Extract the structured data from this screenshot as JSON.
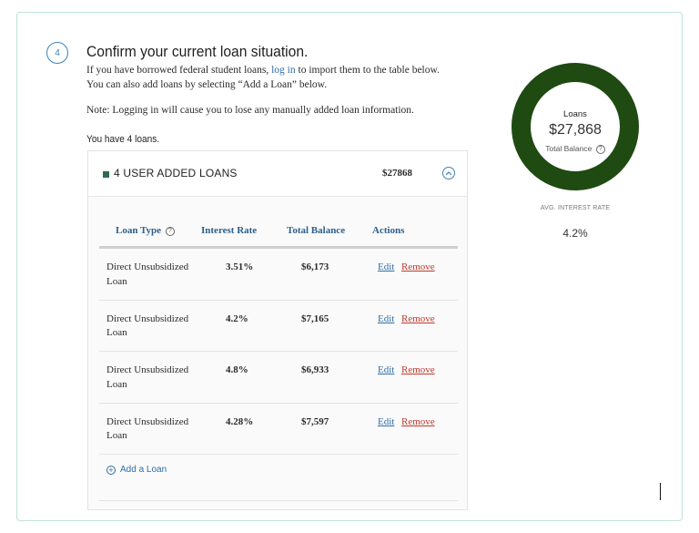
{
  "step": {
    "number": "4",
    "title": "Confirm your current loan situation."
  },
  "intro": {
    "line1_before": "If you have borrowed federal student loans, ",
    "login_link": "log in",
    "line1_after": " to import them to the table below.",
    "line2": "You can also add loans by selecting “Add a Loan” below.",
    "note": "Note: Logging in will cause you to lose any manually added loan information.",
    "loan_count": "You have 4 loans."
  },
  "panel": {
    "label": "4 USER ADDED LOANS",
    "total": "$27868",
    "colors": {
      "group_marker": "#2f6b4f",
      "link": "#2e6da4",
      "remove": "#c0392b"
    }
  },
  "table": {
    "headers": {
      "type": "Loan Type",
      "rate": "Interest Rate",
      "balance": "Total Balance",
      "actions": "Actions"
    },
    "rows": [
      {
        "type": "Direct Unsubsidized Loan",
        "rate": "3.51%",
        "balance": "$6,173",
        "edit": "Edit",
        "remove": "Remove"
      },
      {
        "type": "Direct Unsubsidized Loan",
        "rate": "4.2%",
        "balance": "$7,165",
        "edit": "Edit",
        "remove": "Remove"
      },
      {
        "type": "Direct Unsubsidized Loan",
        "rate": "4.8%",
        "balance": "$6,933",
        "edit": "Edit",
        "remove": "Remove"
      },
      {
        "type": "Direct Unsubsidized Loan",
        "rate": "4.28%",
        "balance": "$7,597",
        "edit": "Edit",
        "remove": "Remove"
      }
    ],
    "add_loan": "Add a Loan"
  },
  "summary": {
    "donut_title": "Loans",
    "amount": "$27,868",
    "sub_label": "Total Balance",
    "avg_label": "AVG. INTEREST RATE",
    "avg_value": "4.2%",
    "donut_color": "#1f4a12"
  },
  "icons": {
    "help": "question-circle-icon",
    "toggle": "chevron-up-circle-icon",
    "add": "plus-circle-icon",
    "help_glyph": "?",
    "add_glyph": "+"
  }
}
